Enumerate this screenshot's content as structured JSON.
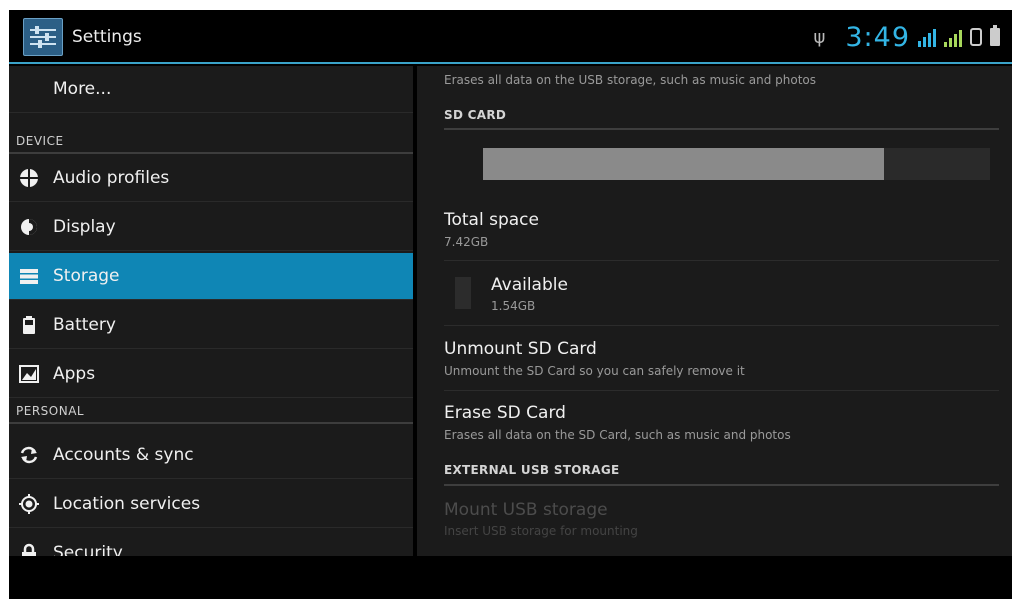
{
  "window": {
    "app_title": "Settings"
  },
  "status_bar": {
    "time": "3:49",
    "usb_icon": "usb-icon",
    "signal_icon": "data-signal-icon",
    "wifi_icon": "signal-bars-icon",
    "bluetooth_icon": "bluetooth-icon",
    "battery_icon": "battery-charging-icon",
    "accent_color": "#33b5e5"
  },
  "sidebar": {
    "more_label": "More...",
    "device_header": "DEVICE",
    "personal_header": "PERSONAL",
    "items": [
      {
        "label": "Audio profiles",
        "icon": "audio-profiles-icon"
      },
      {
        "label": "Display",
        "icon": "display-icon"
      },
      {
        "label": "Storage",
        "icon": "storage-icon",
        "selected": true
      },
      {
        "label": "Battery",
        "icon": "battery-icon"
      },
      {
        "label": "Apps",
        "icon": "apps-icon"
      },
      {
        "label": "Accounts & sync",
        "icon": "sync-icon"
      },
      {
        "label": "Location services",
        "icon": "location-icon"
      },
      {
        "label": "Security",
        "icon": "lock-icon"
      }
    ],
    "selected_color": "#0f86b5"
  },
  "detail": {
    "top_summary": "Erases all data on the USB storage, such as music and photos",
    "sd_card_header": "SD CARD",
    "usage_fraction": 0.79,
    "total_space_title": "Total space",
    "total_space_value": "7.42GB",
    "available_title": "Available",
    "available_value": "1.54GB",
    "unmount_title": "Unmount SD Card",
    "unmount_summary": "Unmount the SD Card so you can safely remove it",
    "erase_title": "Erase SD Card",
    "erase_summary": "Erases all data on the SD Card, such as music and photos",
    "external_usb_header": "EXTERNAL USB STORAGE",
    "mount_usb_title": "Mount USB storage",
    "mount_usb_summary": "Insert USB storage for mounting"
  }
}
